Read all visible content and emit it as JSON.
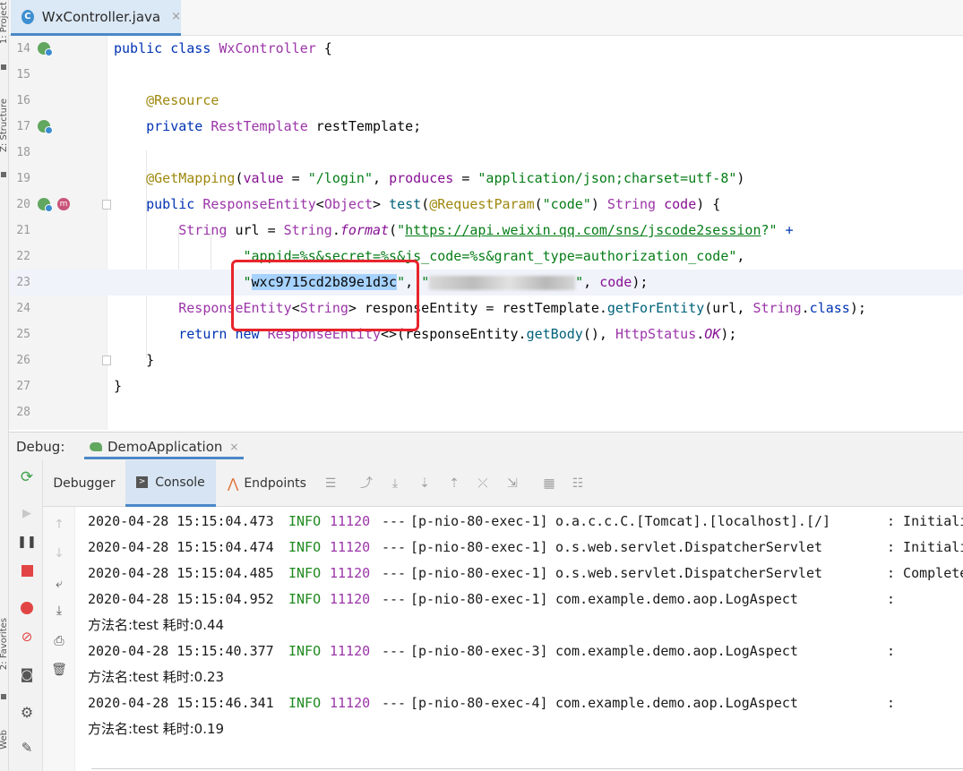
{
  "left_strip": {
    "labels": [
      "1: Project",
      "Z: Structure",
      "2: Favorites",
      "Web"
    ]
  },
  "editor": {
    "tab": {
      "icon": "C",
      "title": "WxController.java",
      "close": "×"
    },
    "lines": [
      {
        "n": "14",
        "parts": [
          [
            "kw",
            "public "
          ],
          [
            "kw",
            "class "
          ],
          [
            "cls",
            "WxController"
          ],
          [
            "t",
            " {"
          ]
        ]
      },
      {
        "n": "15",
        "parts": []
      },
      {
        "n": "16",
        "parts": [
          [
            "t",
            "    "
          ],
          [
            "ann",
            "@Resource"
          ]
        ]
      },
      {
        "n": "17",
        "parts": [
          [
            "t",
            "    "
          ],
          [
            "kw",
            "private "
          ],
          [
            "cls",
            "RestTemplate"
          ],
          [
            "t",
            " restTemplate;"
          ]
        ]
      },
      {
        "n": "18",
        "parts": []
      },
      {
        "n": "19",
        "parts": [
          [
            "t",
            "    "
          ],
          [
            "ann",
            "@GetMapping"
          ],
          [
            "t",
            "("
          ],
          [
            "par",
            "value"
          ],
          [
            "t",
            " = "
          ],
          [
            "str",
            "\"/login\""
          ],
          [
            "t",
            ", "
          ],
          [
            "par",
            "produces"
          ],
          [
            "t",
            " = "
          ],
          [
            "str",
            "\"application/json;charset=utf-8\""
          ],
          [
            "t",
            ")"
          ]
        ]
      },
      {
        "n": "20",
        "parts": [
          [
            "t",
            "    "
          ],
          [
            "kw",
            "public "
          ],
          [
            "cls",
            "ResponseEntity"
          ],
          [
            "t",
            "<"
          ],
          [
            "cls",
            "Object"
          ],
          [
            "t",
            "> "
          ],
          [
            "mth",
            "test"
          ],
          [
            "t",
            "("
          ],
          [
            "ann",
            "@RequestParam"
          ],
          [
            "t",
            "("
          ],
          [
            "str",
            "\"code\""
          ],
          [
            "t",
            ") "
          ],
          [
            "cls",
            "String"
          ],
          [
            "t",
            " "
          ],
          [
            "par",
            "code"
          ],
          [
            "t",
            ") {"
          ]
        ]
      },
      {
        "n": "21",
        "parts": [
          [
            "t",
            "        "
          ],
          [
            "cls",
            "String"
          ],
          [
            "t",
            " url = "
          ],
          [
            "cls",
            "String"
          ],
          [
            "t",
            "."
          ],
          [
            "ital",
            "format"
          ],
          [
            "t",
            "("
          ],
          [
            "str",
            "\""
          ],
          [
            "link",
            "https://api.weixin.qq.com/sns/jscode2session"
          ],
          [
            "str",
            "?\""
          ],
          [
            "t",
            " "
          ],
          [
            "kw",
            "+"
          ]
        ]
      },
      {
        "n": "22",
        "parts": [
          [
            "t",
            "                "
          ],
          [
            "str",
            "\"appid=%s&secret=%s&js_code=%s&grant_type=authorization_code\""
          ],
          [
            "t",
            ","
          ]
        ]
      },
      {
        "n": "23",
        "parts": [
          [
            "t",
            "                "
          ],
          [
            "str",
            "\""
          ],
          [
            "sel",
            "wxc9715cd2b89e1d3c"
          ],
          [
            "str",
            "\""
          ],
          [
            "t",
            ", "
          ],
          [
            "str",
            "\""
          ],
          [
            "blur",
            "                  "
          ],
          [
            "str",
            "\""
          ],
          [
            "t",
            ", "
          ],
          [
            "par",
            "code"
          ],
          [
            "t",
            ");"
          ]
        ]
      },
      {
        "n": "24",
        "parts": [
          [
            "t",
            "        "
          ],
          [
            "cls",
            "ResponseEntity"
          ],
          [
            "t",
            "<"
          ],
          [
            "cls",
            "String"
          ],
          [
            "t",
            "> responseEntity = restTemplate."
          ],
          [
            "mth",
            "getForEntity"
          ],
          [
            "t",
            "(url, "
          ],
          [
            "cls",
            "String"
          ],
          [
            "t",
            "."
          ],
          [
            "kw",
            "class"
          ],
          [
            "t",
            ");"
          ]
        ]
      },
      {
        "n": "25",
        "parts": [
          [
            "t",
            "        "
          ],
          [
            "kw",
            "return "
          ],
          [
            "kw",
            "new "
          ],
          [
            "cls",
            "ResponseEntity"
          ],
          [
            "t",
            "<>(responseEntity."
          ],
          [
            "mth",
            "getBody"
          ],
          [
            "t",
            "(), "
          ],
          [
            "cls",
            "HttpStatus"
          ],
          [
            "t",
            "."
          ],
          [
            "ital",
            "OK"
          ],
          [
            "t",
            ");"
          ]
        ]
      },
      {
        "n": "26",
        "parts": [
          [
            "t",
            "    }"
          ]
        ]
      },
      {
        "n": "27",
        "parts": [
          [
            "t",
            "}"
          ]
        ]
      },
      {
        "n": "28",
        "parts": []
      }
    ]
  },
  "debug": {
    "label": "Debug:",
    "run_config": "DemoApplication",
    "close": "×",
    "tabs": [
      "Debugger",
      "Console",
      "Endpoints"
    ]
  },
  "console": {
    "lines": [
      {
        "kind": "log",
        "ts": "2020-04-28 15:15:04.473",
        "level": "INFO",
        "pid": "11120",
        "sep": "---",
        "thread": "[p-nio-80-exec-1]",
        "logger": "o.a.c.c.C.[Tomcat].[localhost].[/]",
        "msg": ": Initiali"
      },
      {
        "kind": "log",
        "ts": "2020-04-28 15:15:04.474",
        "level": "INFO",
        "pid": "11120",
        "sep": "---",
        "thread": "[p-nio-80-exec-1]",
        "logger": "o.s.web.servlet.DispatcherServlet",
        "msg": ": Initiali"
      },
      {
        "kind": "log",
        "ts": "2020-04-28 15:15:04.485",
        "level": "INFO",
        "pid": "11120",
        "sep": "---",
        "thread": "[p-nio-80-exec-1]",
        "logger": "o.s.web.servlet.DispatcherServlet",
        "msg": ": Complete"
      },
      {
        "kind": "log",
        "ts": "2020-04-28 15:15:04.952",
        "level": "INFO",
        "pid": "11120",
        "sep": "---",
        "thread": "[p-nio-80-exec-1]",
        "logger": "com.example.demo.aop.LogAspect",
        "msg": ":"
      },
      {
        "kind": "text",
        "text": "方法名:test 耗时:0.44"
      },
      {
        "kind": "log",
        "ts": "2020-04-28 15:15:40.377",
        "level": "INFO",
        "pid": "11120",
        "sep": "---",
        "thread": "[p-nio-80-exec-3]",
        "logger": "com.example.demo.aop.LogAspect",
        "msg": ":"
      },
      {
        "kind": "text",
        "text": "方法名:test 耗时:0.23"
      },
      {
        "kind": "log",
        "ts": "2020-04-28 15:15:46.341",
        "level": "INFO",
        "pid": "11120",
        "sep": "---",
        "thread": "[p-nio-80-exec-4]",
        "logger": "com.example.demo.aop.LogAspect",
        "msg": ":"
      },
      {
        "kind": "text",
        "text": "方法名:test 耗时:0.19"
      }
    ]
  },
  "colors": {
    "keyword": "#0033b3",
    "class": "#9b35a8",
    "annotation": "#9e880d",
    "string": "#067d17",
    "info": "#1f8a1f",
    "highlight_box": "#e8242c",
    "selection": "#a6d2ff"
  }
}
